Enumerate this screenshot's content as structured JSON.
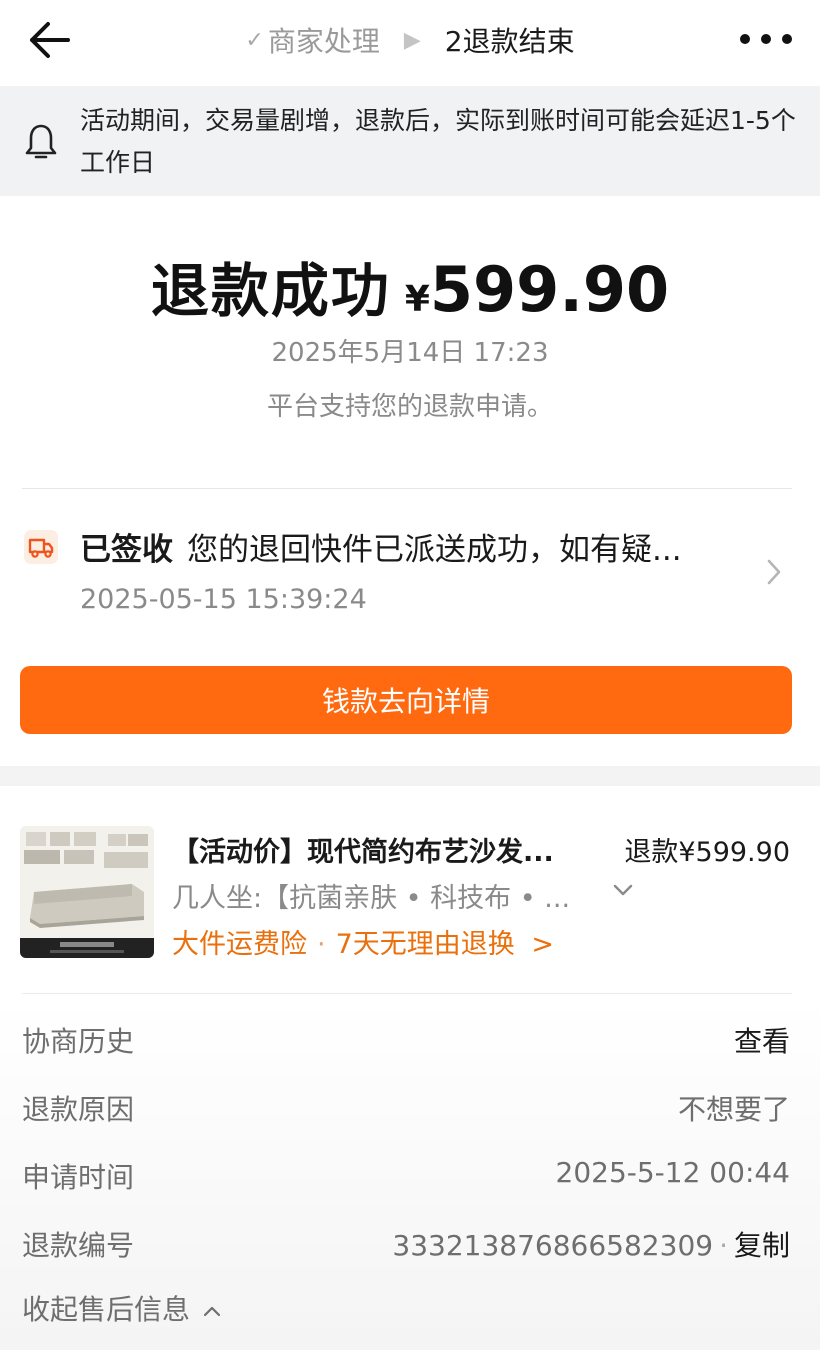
{
  "nav": {
    "prev_step": "商家处理",
    "current_step": "2退款结束"
  },
  "notice": {
    "text": "活动期间，交易量剧增，退款后，实际到账时间可能会延迟1-5个工作日"
  },
  "status": {
    "title": "退款成功",
    "currency": "¥",
    "amount": "599.90",
    "date": "2025年5月14日 17:23",
    "subtitle": "平台支持您的退款申请。"
  },
  "logistics": {
    "status": "已签收",
    "message": "您的退回快件已派送成功，如有疑...",
    "time": "2025-05-15 15:39:24"
  },
  "money_button": {
    "label": "钱款去向详情"
  },
  "product": {
    "title": "【活动价】现代简约布艺沙发...",
    "refund": "退款¥599.90",
    "spec": "几人坐:【抗菌亲肤 • 科技布 • ...",
    "tag1": "大件运费险",
    "tag2": "7天无理由退换",
    "tag_arrow": ">"
  },
  "details": {
    "rows": [
      {
        "label": "协商历史",
        "value": "查看"
      },
      {
        "label": "退款原因",
        "value": "不想要了"
      },
      {
        "label": "申请时间",
        "value": "2025-5-12 00:44"
      },
      {
        "label": "退款编号",
        "value": "3332138768665823​09",
        "action": "复制"
      }
    ],
    "collapse_label": "收起售后信息"
  },
  "colors": {
    "accent": "#ff6a10",
    "tag": "#e9700c",
    "notice_bg": "#f1f2f4"
  }
}
